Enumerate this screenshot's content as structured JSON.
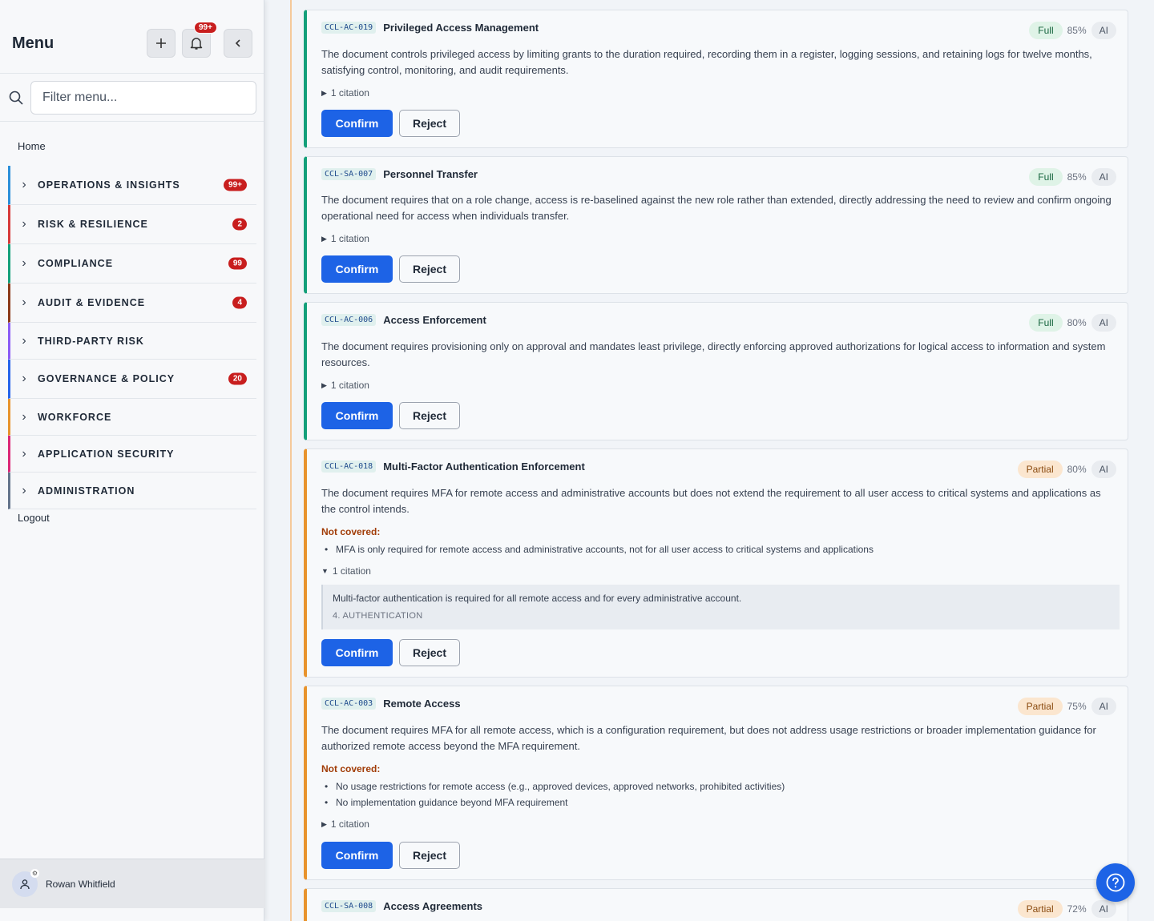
{
  "sidebar": {
    "title": "Menu",
    "notifications_badge": "99+",
    "search_placeholder": "Filter menu...",
    "home_label": "Home",
    "logout_label": "Logout",
    "user_name": "Rowan Whitfield",
    "groups": [
      {
        "label": "OPERATIONS & INSIGHTS",
        "badge": "99+",
        "color": "#2b8fd9"
      },
      {
        "label": "RISK & RESILIENCE",
        "badge": "2",
        "color": "#d63a3a"
      },
      {
        "label": "COMPLIANCE",
        "badge": "99",
        "color": "#14a07a"
      },
      {
        "label": "AUDIT & EVIDENCE",
        "badge": "4",
        "color": "#8b3a1a"
      },
      {
        "label": "THIRD-PARTY RISK",
        "badge": "",
        "color": "#8b5cf6"
      },
      {
        "label": "GOVERNANCE & POLICY",
        "badge": "20",
        "color": "#2563eb"
      },
      {
        "label": "WORKFORCE",
        "badge": "",
        "color": "#e8932d"
      },
      {
        "label": "APPLICATION SECURITY",
        "badge": "",
        "color": "#db2777"
      },
      {
        "label": "ADMINISTRATION",
        "badge": "",
        "color": "#64748b"
      }
    ]
  },
  "cards": [
    {
      "code": "CCL-AC-019",
      "title": "Privileged Access Management",
      "status": "Full",
      "pct": "85%",
      "ai": "AI",
      "description": "The document controls privileged access by limiting grants to the duration required, recording them in a register, logging sessions, and retaining logs for twelve months, satisfying control, monitoring, and audit requirements.",
      "citation": "1 citation",
      "confirm": "Confirm",
      "reject": "Reject"
    },
    {
      "code": "CCL-SA-007",
      "title": "Personnel Transfer",
      "status": "Full",
      "pct": "85%",
      "ai": "AI",
      "description": "The document requires that on a role change, access is re-baselined against the new role rather than extended, directly addressing the need to review and confirm ongoing operational need for access when individuals transfer.",
      "citation": "1 citation",
      "confirm": "Confirm",
      "reject": "Reject"
    },
    {
      "code": "CCL-AC-006",
      "title": "Access Enforcement",
      "status": "Full",
      "pct": "80%",
      "ai": "AI",
      "description": "The document requires provisioning only on approval and mandates least privilege, directly enforcing approved authorizations for logical access to information and system resources.",
      "citation": "1 citation",
      "confirm": "Confirm",
      "reject": "Reject"
    },
    {
      "code": "CCL-AC-018",
      "title": "Multi-Factor Authentication Enforcement",
      "status": "Partial",
      "pct": "80%",
      "ai": "AI",
      "description": "The document requires MFA for remote access and administrative accounts but does not extend the requirement to all user access to critical systems and applications as the control intends.",
      "not_covered_label": "Not covered:",
      "not_covered": [
        "MFA is only required for remote access and administrative accounts, not for all user access to critical systems and applications"
      ],
      "citation": "1 citation",
      "quote": "Multi-factor authentication is required for all remote access and for every administrative account.",
      "quote_ref": "4. AUTHENTICATION",
      "confirm": "Confirm",
      "reject": "Reject"
    },
    {
      "code": "CCL-AC-003",
      "title": "Remote Access",
      "status": "Partial",
      "pct": "75%",
      "ai": "AI",
      "description": "The document requires MFA for all remote access, which is a configuration requirement, but does not address usage restrictions or broader implementation guidance for authorized remote access beyond the MFA requirement.",
      "not_covered_label": "Not covered:",
      "not_covered": [
        "No usage restrictions for remote access (e.g., approved devices, approved networks, prohibited activities)",
        "No implementation guidance beyond MFA requirement"
      ],
      "citation": "1 citation",
      "confirm": "Confirm",
      "reject": "Reject"
    },
    {
      "code": "CCL-SA-008",
      "title": "Access Agreements",
      "status": "Partial",
      "pct": "72%",
      "ai": "AI"
    }
  ]
}
